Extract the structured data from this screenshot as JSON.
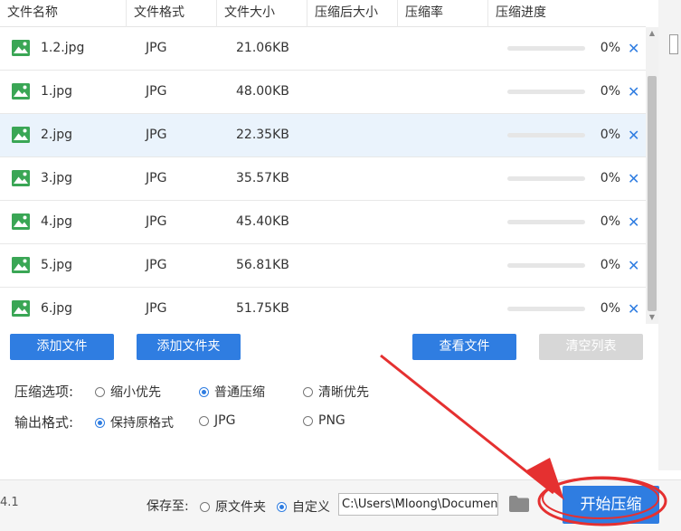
{
  "columns": [
    "文件名称",
    "文件格式",
    "文件大小",
    "压缩后大小",
    "压缩率",
    "压缩进度"
  ],
  "files": [
    {
      "name": "1.2.jpg",
      "format": "JPG",
      "size": "21.06KB",
      "progress": "0%",
      "progress_value": 0
    },
    {
      "name": "1.jpg",
      "format": "JPG",
      "size": "48.00KB",
      "progress": "0%",
      "progress_value": 0
    },
    {
      "name": "2.jpg",
      "format": "JPG",
      "size": "22.35KB",
      "progress": "0%",
      "progress_value": 0
    },
    {
      "name": "3.jpg",
      "format": "JPG",
      "size": "35.57KB",
      "progress": "0%",
      "progress_value": 0
    },
    {
      "name": "4.jpg",
      "format": "JPG",
      "size": "45.40KB",
      "progress": "0%",
      "progress_value": 0
    },
    {
      "name": "5.jpg",
      "format": "JPG",
      "size": "56.81KB",
      "progress": "0%",
      "progress_value": 0
    },
    {
      "name": "6.jpg",
      "format": "JPG",
      "size": "51.75KB",
      "progress": "0%",
      "progress_value": 0
    }
  ],
  "selected_row": 2,
  "row_icon": "image-file-icon",
  "delete_icon": "close-icon",
  "delete_glyph": "✕",
  "buttons": {
    "add_file": "添加文件",
    "add_folder": "添加文件夹",
    "view_file": "查看文件",
    "clear_list": "清空列表",
    "start": "开始压缩"
  },
  "compress_options": {
    "label": "压缩选项:",
    "options": [
      "缩小优先",
      "普通压缩",
      "清晰优先"
    ],
    "selected": 1
  },
  "output_format": {
    "label": "输出格式:",
    "options": [
      "保持原格式",
      "JPG",
      "PNG"
    ],
    "selected": 0
  },
  "footer": {
    "version": "4.1",
    "save_to_label": "保存至:",
    "save_options": [
      "原文件夹",
      "自定义"
    ],
    "save_selected": 1,
    "path_value": "C:\\Users\\Mloong\\Documents",
    "folder_icon": "folder-icon"
  },
  "colors": {
    "accent": "#2f7de1",
    "selected_row": "#eaf3fc",
    "button_disabled": "#d7d7d7",
    "annotation": "#e53030",
    "icon_green": "#3aa655"
  }
}
